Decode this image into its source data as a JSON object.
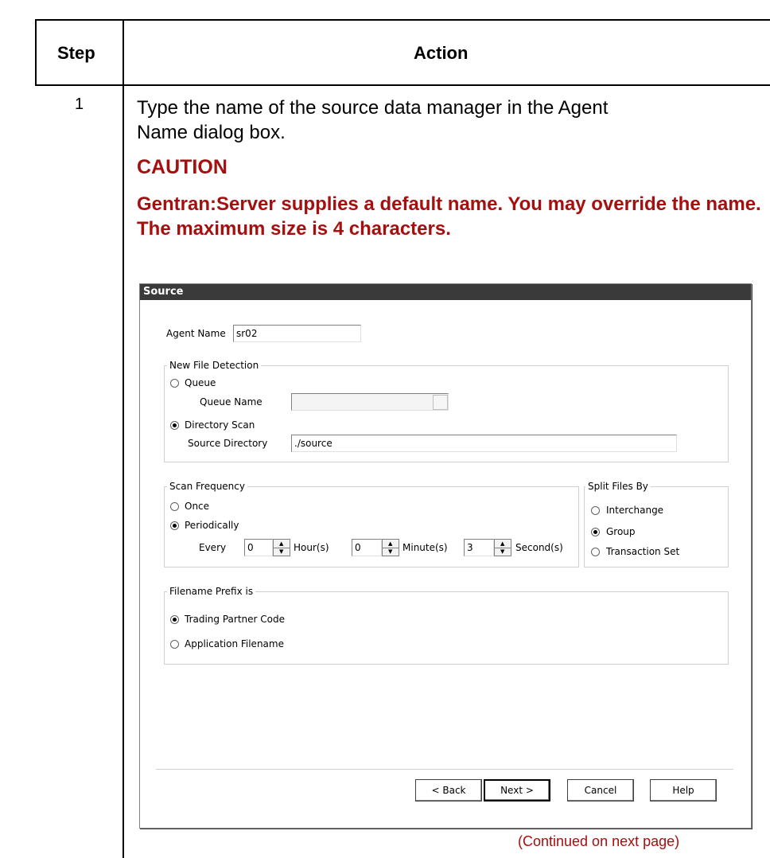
{
  "table": {
    "col_step": "Step",
    "col_action": "Action",
    "step_number": "1",
    "instruction": "Type the name of the source data manager in the Agent Name dialog box.",
    "caution_title": "CAUTION",
    "caution_text": "Gentran:Server supplies a default name. You may override the name. The maximum size is 4 characters.",
    "continued": "(Continued on next page)"
  },
  "dialog": {
    "title": "Source",
    "agent_name_label": "Agent Name",
    "agent_name_value": "sr02",
    "new_file_detection": {
      "title": "New File Detection",
      "queue_label": "Queue",
      "queue_name_label": "Queue Name",
      "queue_name_value": "",
      "directory_scan_label": "Directory Scan",
      "source_directory_label": "Source Directory",
      "source_directory_value": "./source",
      "selected": "Directory Scan"
    },
    "scan_frequency": {
      "title": "Scan Frequency",
      "once_label": "Once",
      "periodically_label": "Periodically",
      "selected": "Periodically",
      "every_label": "Every",
      "hours_value": "0",
      "hours_label": "Hour(s)",
      "minutes_value": "0",
      "minutes_label": "Minute(s)",
      "seconds_value": "3",
      "seconds_label": "Second(s)"
    },
    "split_files_by": {
      "title": "Split Files By",
      "interchange_label": "Interchange",
      "group_label": "Group",
      "transaction_set_label": "Transaction Set",
      "selected": "Group"
    },
    "filename_prefix": {
      "title": "Filename Prefix is",
      "trading_partner_label": "Trading Partner Code",
      "application_filename_label": "Application Filename",
      "selected": "Trading Partner Code"
    },
    "buttons": {
      "back": "< Back",
      "next": "Next >",
      "cancel": "Cancel",
      "help": "Help"
    }
  },
  "colors": {
    "caution": "#a50f0f",
    "titlebar": "#3a3a3a"
  }
}
